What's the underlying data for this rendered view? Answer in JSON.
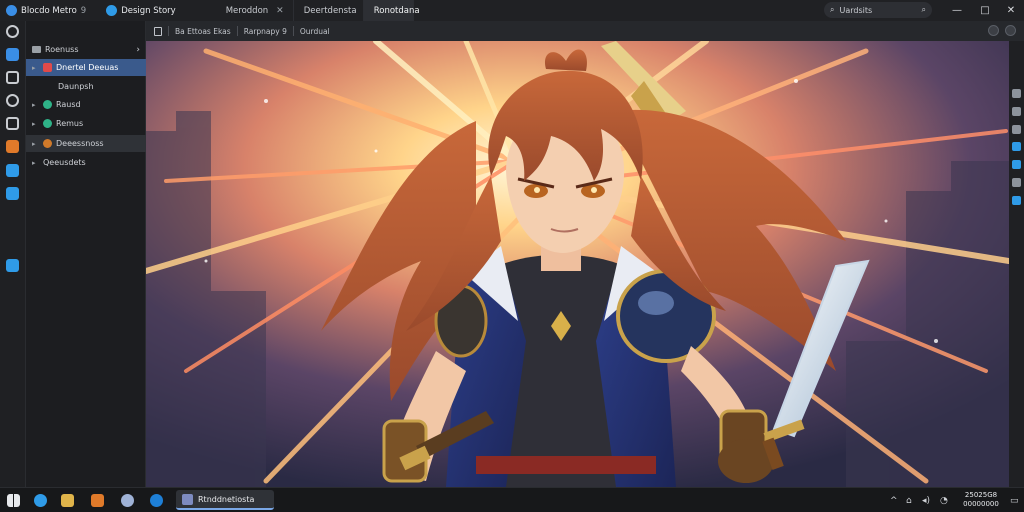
{
  "titlebar": {
    "app_title": "Blocdo Metro",
    "app_badge_count": "9",
    "second_app_title": "Design Story",
    "tabs": [
      {
        "label": "Meroddon",
        "active": false,
        "has_close": true
      },
      {
        "label": "Deertdensta",
        "active": false,
        "has_close": false
      },
      {
        "label": "Ronotdana",
        "active": true,
        "has_close": false
      }
    ],
    "search": {
      "value": "Uardsits"
    },
    "window_controls": [
      "—",
      "□",
      "✕"
    ]
  },
  "toolbar": {
    "crumbs": [
      "Ba Ettoas Ekas",
      "Rarpnapy 9",
      "Ourdual"
    ]
  },
  "sidebar": {
    "header": "Roenuss",
    "items": [
      {
        "label": "Dnertel Deeuas",
        "icon_color": "#e04a4a",
        "state": "selected",
        "chevron": "▸"
      },
      {
        "label": "Daunpsh",
        "icon_color": "",
        "state": "normal",
        "chevron": ""
      },
      {
        "label": "Rausd",
        "icon_color": "#2fb388",
        "state": "normal",
        "chevron": "▸"
      },
      {
        "label": "Remus",
        "icon_color": "#2fb388",
        "state": "normal",
        "chevron": "▸"
      },
      {
        "label": "Deeessnoss",
        "icon_color": "#d07a2a",
        "state": "hover",
        "chevron": "▸"
      },
      {
        "label": "Qeeusdets",
        "icon_color": "",
        "state": "normal",
        "chevron": "▸"
      }
    ]
  },
  "rail_icons": [
    {
      "name": "chat-icon",
      "color": "#9aa0a6"
    },
    {
      "name": "files-icon",
      "color": "#3a8ee6"
    },
    {
      "name": "copy-icon",
      "color": "#9aa0a6"
    },
    {
      "name": "clock-icon",
      "color": "#9aa0a6"
    },
    {
      "name": "folder-icon",
      "color": "#9aa0a6"
    },
    {
      "name": "bookmark-icon",
      "color": "#e07a2a"
    },
    {
      "name": "brush-icon",
      "color": "#2f9be8"
    },
    {
      "name": "cube-icon",
      "color": "#2f9be8"
    },
    {
      "name": "pen-icon",
      "color": "#2f9be8"
    }
  ],
  "taskbar": {
    "active_app_label": "Rtnddnetiosta",
    "clock_line1": "25025G8",
    "clock_line2": "00000000",
    "tray_icons": [
      "^",
      "⌂",
      "◂)",
      "◔",
      "▭"
    ]
  },
  "colors": {
    "accent": "#3a5a8c",
    "titlebar_bg": "#202124",
    "sidebar_bg": "#1c1d20",
    "taskbar_bg": "#17181a"
  }
}
